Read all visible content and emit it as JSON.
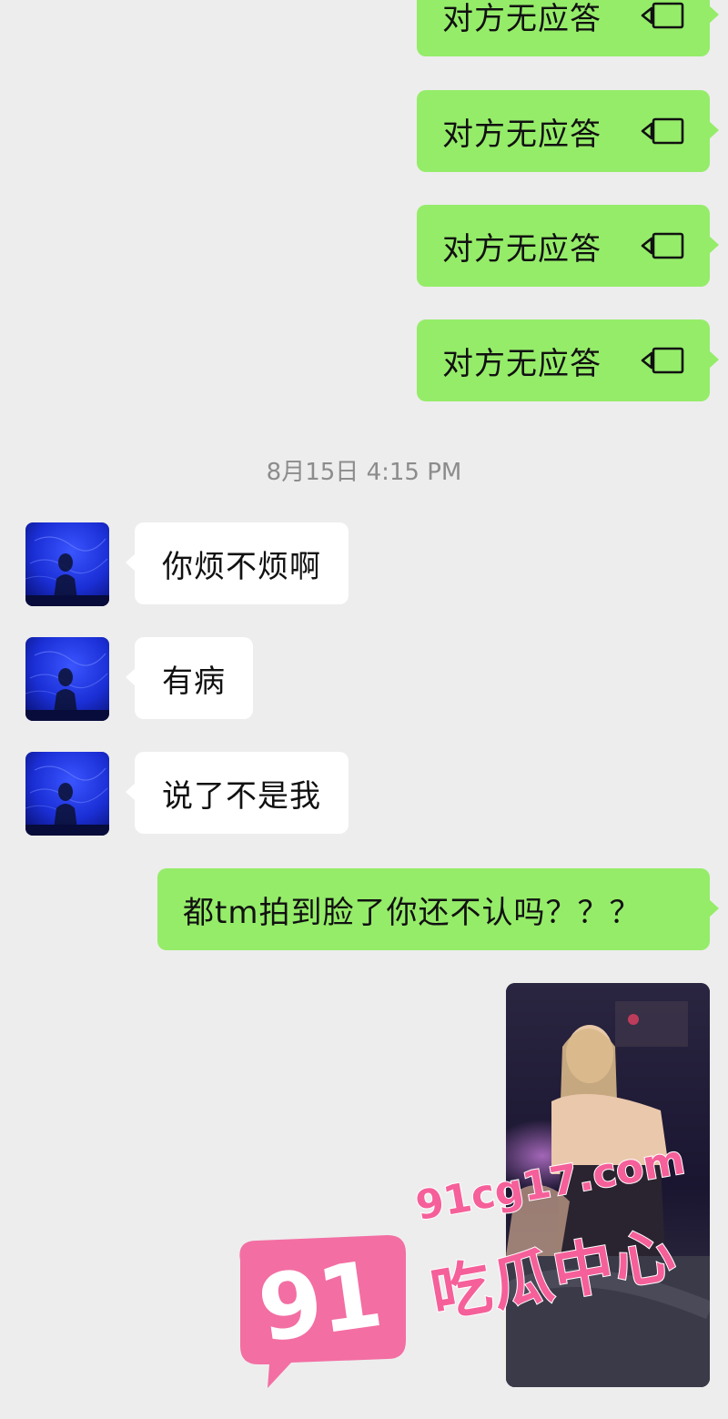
{
  "calls": [
    {
      "text": "对方无应答",
      "icon": "video-call-icon"
    },
    {
      "text": "对方无应答",
      "icon": "video-call-icon"
    },
    {
      "text": "对方无应答",
      "icon": "video-call-icon"
    },
    {
      "text": "对方无应答",
      "icon": "video-call-icon"
    }
  ],
  "timestamp": "8月15日 4:15 PM",
  "incoming": [
    {
      "text": "你烦不烦啊"
    },
    {
      "text": "有病"
    },
    {
      "text": "说了不是我"
    }
  ],
  "outgoing_text": "都tm拍到脸了你还不认吗？？？",
  "watermark": {
    "badge": "91",
    "url": "91cg17.com",
    "title": "吃瓜中心"
  },
  "colors": {
    "background": "#ededed",
    "outgoing_bubble": "#95ec69",
    "incoming_bubble": "#ffffff",
    "timestamp_text": "#8c8c8c",
    "watermark_pink": "#f5609a",
    "avatar_blue": "#1b2fd6"
  }
}
